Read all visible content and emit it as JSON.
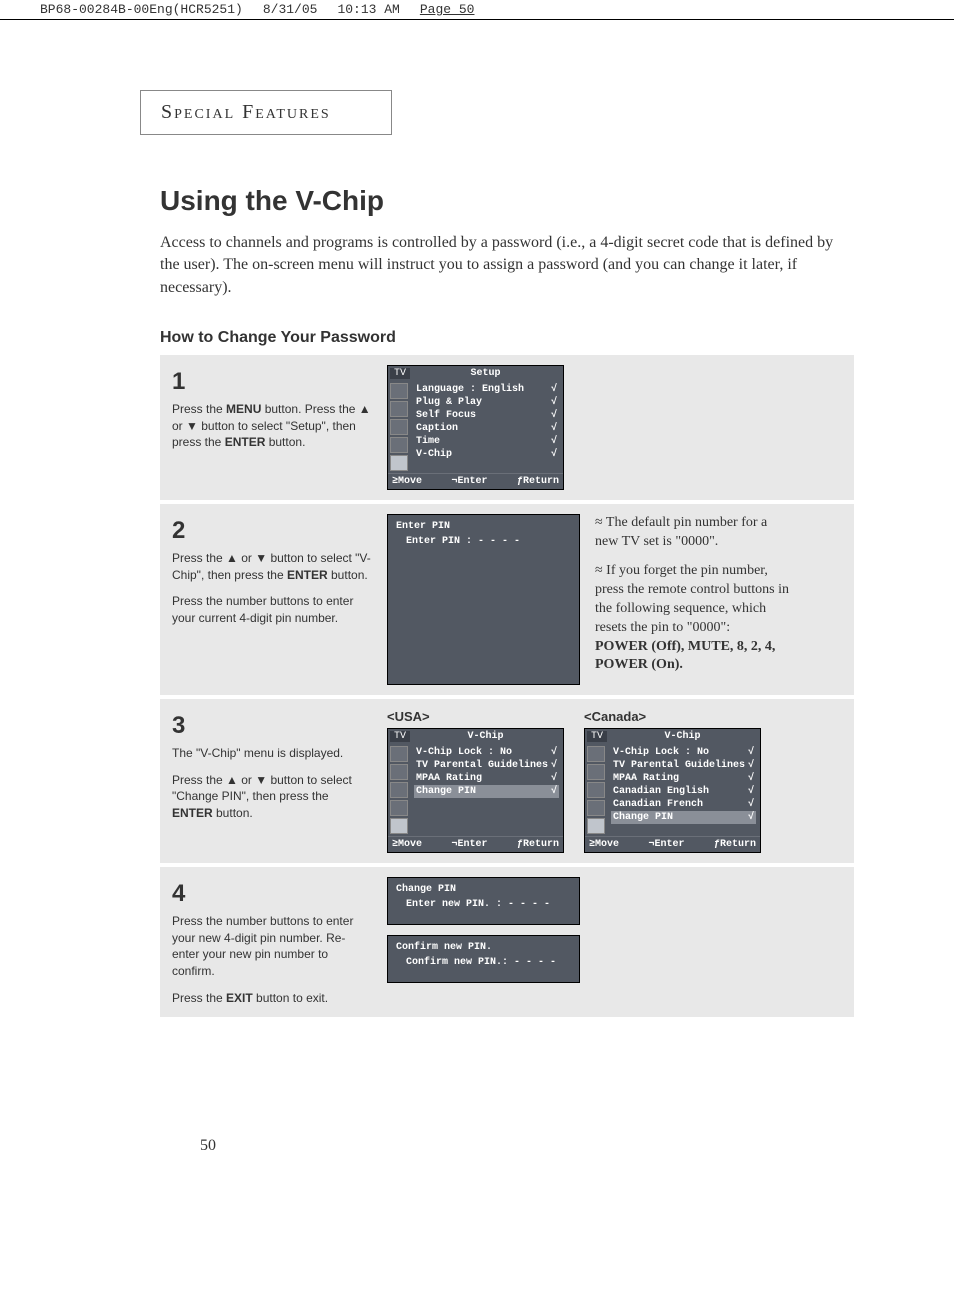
{
  "header": {
    "doc_id": "BP68-00284B-00Eng(HCR5251)",
    "date": "8/31/05",
    "time": "10:13 AM",
    "page_label": "Page 50"
  },
  "section_label": "Special Features",
  "title": "Using the V-Chip",
  "intro": "Access to channels and programs is controlled by a password (i.e., a 4-digit secret code that is defined by the user). The on-screen menu will instruct you to assign a password (and you can change it later, if necessary).",
  "subheading": "How to Change Your Password",
  "step1": {
    "num": "1",
    "text_parts": [
      "Press the ",
      "MENU",
      " button. Press the ▲ or ▼ button to select \"Setup\", then press the ",
      "ENTER",
      " button."
    ]
  },
  "osd1": {
    "tag": "TV",
    "title": "Setup",
    "rows": [
      {
        "label": "Language  :  English",
        "arrow": "√"
      },
      {
        "label": "Plug & Play",
        "arrow": "√"
      },
      {
        "label": "Self Focus",
        "arrow": "√"
      },
      {
        "label": "Caption",
        "arrow": "√"
      },
      {
        "label": "Time",
        "arrow": "√"
      },
      {
        "label": "V-Chip",
        "arrow": "√"
      }
    ],
    "footer": {
      "move": "≥Move",
      "enter": "¬Enter",
      "ret": "ƒReturn"
    }
  },
  "step2": {
    "num": "2",
    "text_parts": [
      "Press the ▲ or ▼ button to select \"V-Chip\", then press the ",
      "ENTER",
      " button."
    ],
    "extra": "Press the number buttons to enter your current 4-digit pin number."
  },
  "osd2": {
    "title": "Enter PIN",
    "line": "Enter PIN       : - - - -"
  },
  "notes": {
    "n1": "≈ The default pin number for a new TV set is \"0000\".",
    "n2_a": "≈ If you forget the pin number, press the remote control buttons in the following sequence, which resets the pin to \"0000\":",
    "n2_b": "POWER (Off), MUTE, 8, 2, 4, POWER (On)."
  },
  "step3": {
    "num": "3",
    "text_a": "The \"V-Chip\" menu is displayed.",
    "text_parts": [
      "Press the ▲ or ▼ button to select \"Change PIN\", then press the ",
      "ENTER",
      " button."
    ]
  },
  "region_usa": "<USA>",
  "region_can": "<Canada>",
  "osd3a": {
    "tag": "TV",
    "title": "V-Chip",
    "rows": [
      {
        "label": "V-Chip Lock      :  No",
        "arrow": "√"
      },
      {
        "label": "TV Parental Guidelines",
        "arrow": "√"
      },
      {
        "label": "MPAA Rating",
        "arrow": "√"
      },
      {
        "label": "Change PIN",
        "arrow": "√",
        "hl": true
      }
    ],
    "footer": {
      "move": "≥Move",
      "enter": "¬Enter",
      "ret": "ƒReturn"
    }
  },
  "osd3b": {
    "tag": "TV",
    "title": "V-Chip",
    "rows": [
      {
        "label": "V-Chip Lock      :  No",
        "arrow": "√"
      },
      {
        "label": "TV Parental Guidelines",
        "arrow": "√"
      },
      {
        "label": "MPAA Rating",
        "arrow": "√"
      },
      {
        "label": "Canadian English",
        "arrow": "√"
      },
      {
        "label": "Canadian French",
        "arrow": "√"
      },
      {
        "label": "Change PIN",
        "arrow": "√",
        "hl": true
      }
    ],
    "footer": {
      "move": "≥Move",
      "enter": "¬Enter",
      "ret": "ƒReturn"
    }
  },
  "step4": {
    "num": "4",
    "text_a": "Press the number buttons to enter your new 4-digit pin number. Re-enter your new pin number  to confirm.",
    "text_parts": [
      "Press the ",
      "EXIT",
      " button to exit."
    ]
  },
  "osd4a": {
    "title": "Change PIN",
    "line": "Enter new PIN. : - - - -"
  },
  "osd4b": {
    "title": "Confirm new PIN.",
    "line": "Confirm new PIN.: - - - -"
  },
  "page_number": "50"
}
